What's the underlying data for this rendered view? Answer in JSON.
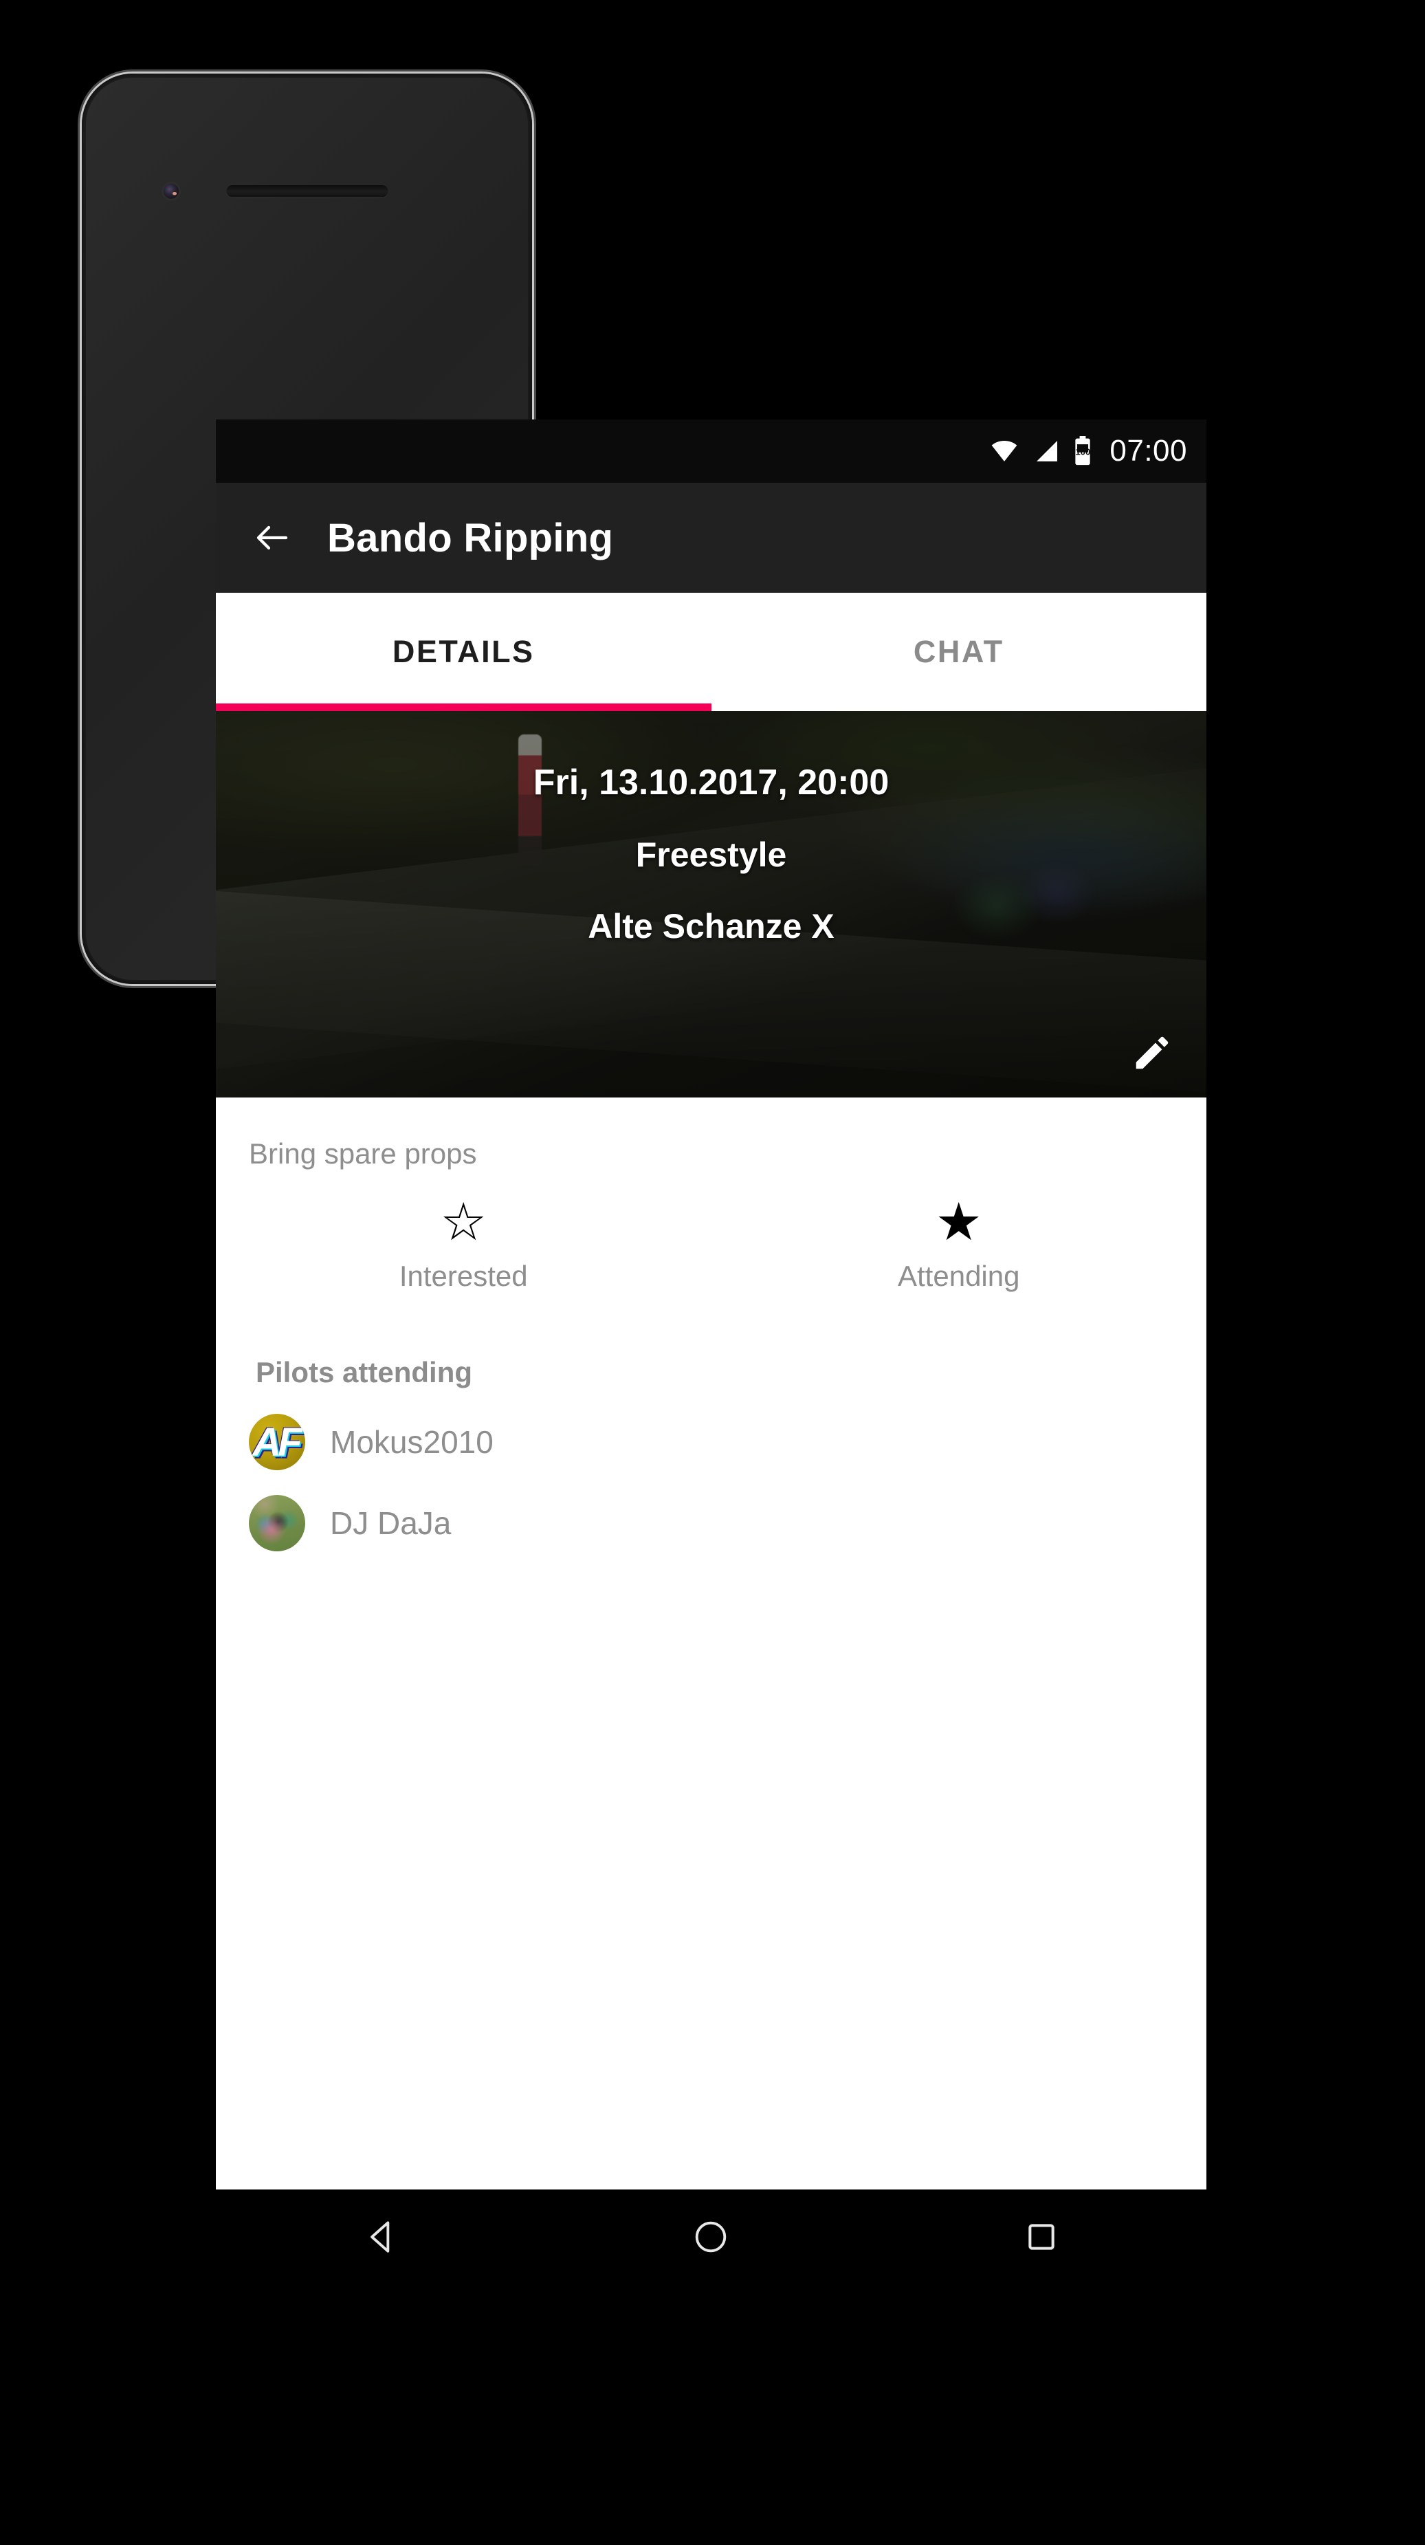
{
  "status_bar": {
    "wifi_icon": "wifi-icon",
    "signal_icon": "cellular-signal-icon",
    "battery_icon": "battery-icon",
    "battery_level": "100",
    "time": "07:00"
  },
  "toolbar": {
    "back_icon": "back-arrow-icon",
    "title": "Bando Ripping",
    "background_color": "#212121"
  },
  "tabs": {
    "items": [
      {
        "label": "DETAILS",
        "active": true
      },
      {
        "label": "CHAT",
        "active": false
      }
    ],
    "indicator_color": "#F50057"
  },
  "hero": {
    "datetime": "Fri, 13.10.2017, 20:00",
    "category": "Freestyle",
    "location": "Alte Schanze X",
    "edit_icon": "pencil-edit-icon"
  },
  "details": {
    "description": "Bring spare props",
    "rsvp": [
      {
        "label": "Interested",
        "star": "☆",
        "selected": false
      },
      {
        "label": "Attending",
        "star": "★",
        "selected": true
      }
    ],
    "pilots_heading": "Pilots attending",
    "pilots": [
      {
        "name": "Mokus2010",
        "avatar": "avatar-monogram-af",
        "monogram": "AF"
      },
      {
        "name": "DJ DaJa",
        "avatar": "avatar-photo-drone"
      }
    ]
  },
  "nav_bar": {
    "back": "nav-back-triangle-icon",
    "home": "nav-home-circle-icon",
    "recents": "nav-recents-square-icon"
  }
}
